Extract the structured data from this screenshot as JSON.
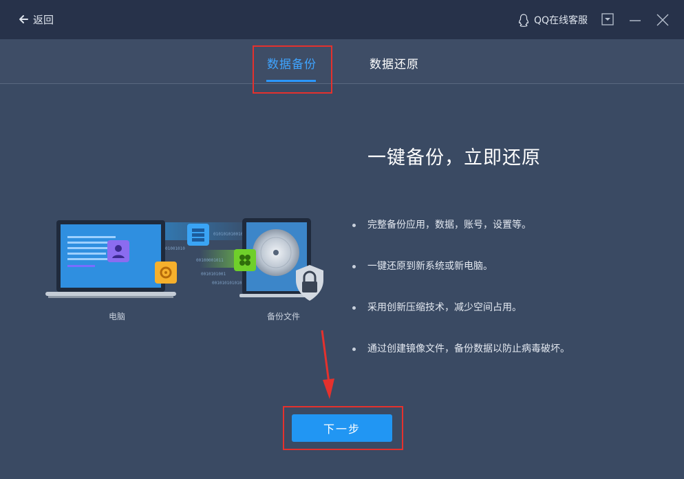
{
  "titlebar": {
    "back_label": "返回",
    "support_label": "QQ在线客服"
  },
  "tabs": [
    {
      "label": "数据备份",
      "active": true
    },
    {
      "label": "数据还原",
      "active": false
    }
  ],
  "main": {
    "headline": "一键备份，立即还原",
    "features": [
      "完整备份应用，数据，账号，设置等。",
      "一键还原到新系统或新电脑。",
      "采用创新压缩技术，减少空间占用。",
      "通过创建镜像文件，备份数据以防止病毒破坏。"
    ],
    "illustration": {
      "computer_label": "电脑",
      "backup_label": "备份文件"
    },
    "next_label": "下一步"
  },
  "colors": {
    "accent": "#2196f3",
    "annotation_red": "#e5312d",
    "titlebar_bg": "#27324a",
    "body_bg": "#3a4a63"
  },
  "icons": [
    "arrow-left-icon",
    "qq-penguin-icon",
    "dropdown-menu-icon",
    "minimize-icon",
    "close-icon",
    "laptop-icon",
    "backup-disk-icon",
    "lock-icon",
    "user-icon",
    "gear-icon",
    "server-icon",
    "clover-icon",
    "annotation-arrow-icon"
  ]
}
